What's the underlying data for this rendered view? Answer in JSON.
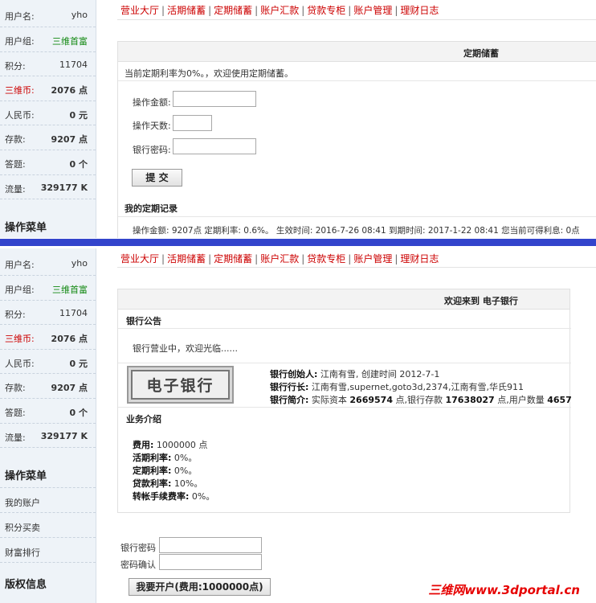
{
  "sidebar": {
    "rows": [
      {
        "label": "用户名:",
        "value": "yho"
      },
      {
        "label": "用户组:",
        "value": "三维首富"
      },
      {
        "label": "积分:",
        "value": "11704"
      },
      {
        "label": "三维币:",
        "value": "2076 点"
      },
      {
        "label": "人民币:",
        "value": "0 元"
      },
      {
        "label": "存款:",
        "value": "9207 点"
      },
      {
        "label": "答题:",
        "value": "0 个"
      },
      {
        "label": "流量:",
        "value": "329177 K"
      }
    ],
    "menu_title": "操作菜单",
    "menu_items": [
      "我的账户",
      "积分买卖",
      "财富排行"
    ],
    "copyright_title": "版权信息"
  },
  "nav": [
    "营业大厅",
    "活期储蓄",
    "定期储蓄",
    "账户汇款",
    "贷款专柜",
    "账户管理",
    "理财日志"
  ],
  "deposit": {
    "title": "定期储蓄",
    "notice": "当前定期利率为0%。，欢迎使用定期储蓄。",
    "amount_label": "操作金额:",
    "days_label": "操作天数:",
    "password_label": "银行密码:",
    "submit": "提 交",
    "records_title": "我的定期记录",
    "record": "操作金额: 9207点    定期利率: 0.6%。 生效时间: 2016-7-26 08:41   到期时间: 2017-1-22 08:41   您当前可得利息: 0点"
  },
  "bank": {
    "title": "欢迎来到 电子银行",
    "announce_title": "银行公告",
    "announce_text": "银行营业中，欢迎光临......",
    "logo_text": "电子银行",
    "founder_label": "银行创始人:",
    "founder_value": "江南有雪, 创建时间 2012-7-1",
    "president_label": "银行行长:",
    "president_value": "江南有雪,supernet,goto3d,2374,江南有雪,华氏911",
    "intro_label": "银行简介:",
    "intro_p1": "实际资本",
    "intro_capital": "2669574",
    "intro_p2": "点,银行存款",
    "intro_deposit": "17638027",
    "intro_p3": "点,用户数量",
    "intro_users": "4657",
    "service_title": "业务介绍",
    "services": [
      {
        "label": "费用:",
        "value": "1000000 点"
      },
      {
        "label": "活期利率:",
        "value": "0%。"
      },
      {
        "label": "定期利率:",
        "value": "0%。"
      },
      {
        "label": "贷款利率:",
        "value": "10%。"
      },
      {
        "label": "转帐手续费率:",
        "value": "0%。"
      }
    ],
    "password_label": "银行密码",
    "confirm_label": "密码确认",
    "open_button": "我要开户(费用:1000000点)"
  },
  "watermark": "三维网www.3dportal.cn"
}
